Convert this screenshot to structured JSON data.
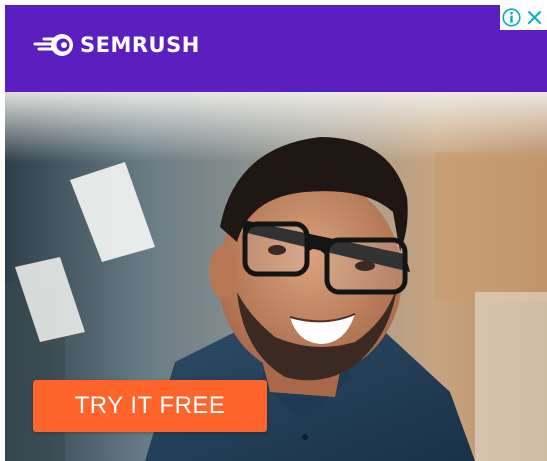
{
  "ad": {
    "brand": {
      "name": "SEMRUSH",
      "icon": "semrush-fireball-logo"
    },
    "adchoices": {
      "info_icon": "info-icon",
      "close_icon": "close-icon"
    },
    "photo": {
      "subject": "smiling-man-with-glasses-photo"
    },
    "cta": {
      "label": "TRY IT FREE"
    }
  },
  "colors": {
    "header_bg": "#5b1fbf",
    "cta_bg": "#ff642d",
    "adchoices_blue": "#00aecd",
    "white": "#ffffff"
  }
}
